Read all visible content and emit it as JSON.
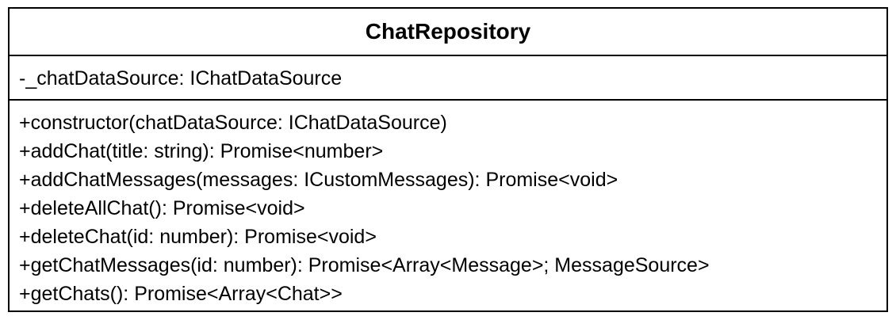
{
  "class_diagram": {
    "class_name": "ChatRepository",
    "attributes": [
      "-_chatDataSource: IChatDataSource"
    ],
    "methods": [
      "+constructor(chatDataSource: IChatDataSource)",
      "+addChat(title: string): Promise<number>",
      "+addChatMessages(messages: ICustomMessages): Promise<void>",
      "+deleteAllChat(): Promise<void>",
      "+deleteChat(id: number): Promise<void>",
      "+getChatMessages(id: number): Promise<Array<Message>; MessageSource>",
      "+getChats(): Promise<Array<Chat>>"
    ]
  }
}
